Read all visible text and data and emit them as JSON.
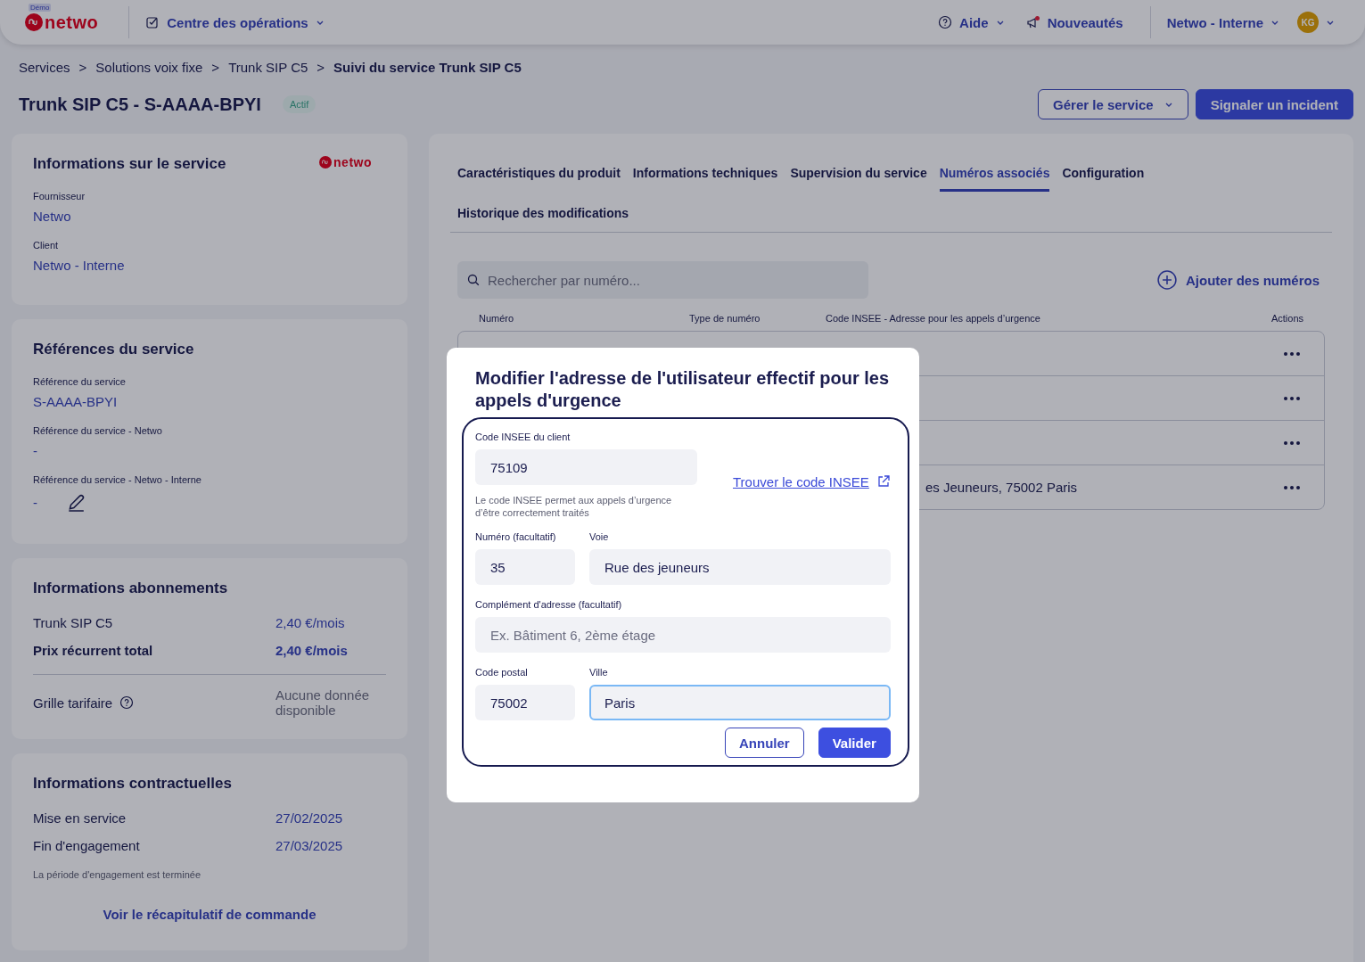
{
  "topbar": {
    "logo": {
      "badge": "Démo",
      "text": "netwo"
    },
    "menu": {
      "label": "Centre des opérations"
    },
    "actions": [
      {
        "kind": "help",
        "label": "Aide",
        "dropdown": true
      },
      {
        "kind": "news",
        "label": "Nouveautés",
        "dropdown": false
      }
    ],
    "account": {
      "label": "Netwo - Interne"
    },
    "avatar": {
      "initials": "KG"
    }
  },
  "breadcrumb": {
    "separator": ">",
    "items": [
      "Services",
      "Solutions voix fixe",
      "Trunk SIP C5",
      "Suivi du service Trunk SIP C5"
    ]
  },
  "header": {
    "title": "Trunk SIP C5 - S-AAAA-BPYI",
    "status": "Actif",
    "buttons": [
      {
        "kind": "outline",
        "label": "Gérer le service",
        "dropdown": true
      },
      {
        "kind": "primary",
        "label": "Signaler un incident",
        "dropdown": false
      }
    ]
  },
  "cards": [
    {
      "kind": "fields",
      "title": "Informations sur le service",
      "logo": "netwo",
      "fields": [
        {
          "label": "Fournisseur",
          "value": "Netwo",
          "editable": false
        },
        {
          "label": "Client",
          "value": "Netwo - Interne",
          "editable": false
        }
      ]
    },
    {
      "kind": "fields",
      "title": "Références du service",
      "fields": [
        {
          "label": "Référence du service",
          "value": "S-AAAA-BPYI",
          "editable": false
        },
        {
          "label": "Référence du service - Netwo",
          "value": "-",
          "editable": false
        },
        {
          "label": "Référence du service - Netwo - Interne",
          "value": "-",
          "editable": true
        }
      ]
    },
    {
      "kind": "prices",
      "title": "Informations abonnements",
      "rows": [
        {
          "label": "Trunk SIP C5",
          "value": "2,40 €/mois",
          "bold": false
        },
        {
          "label": "Prix récurrent total",
          "value": "2,40 €/mois",
          "bold": true
        }
      ],
      "tariff": {
        "label": "Grille tarifaire",
        "value": "Aucune donnée disponible"
      }
    },
    {
      "kind": "contract",
      "title": "Informations contractuelles",
      "rows": [
        {
          "label": "Mise en service",
          "value": "27/02/2025",
          "bold": false
        },
        {
          "label": "Fin d'engagement",
          "value": "27/03/2025",
          "bold": false
        }
      ],
      "note": "La période d'engagement est terminée",
      "link": "Voir le récapitulatif de commande"
    }
  ],
  "panel": {
    "tabs": [
      {
        "label": "Caractéristiques du produit",
        "selected": false
      },
      {
        "label": "Informations techniques",
        "selected": false
      },
      {
        "label": "Supervision du service",
        "selected": false
      },
      {
        "label": "Numéros associés",
        "selected": true
      },
      {
        "label": "Configuration",
        "selected": false
      },
      {
        "label": "Historique des modifications",
        "selected": false
      }
    ],
    "search": {
      "placeholder": "Rechercher par numéro..."
    },
    "add_button": "Ajouter des numéros",
    "table": {
      "columns": [
        "Numéro",
        "Type de numéro",
        "Code INSEE - Adresse pour les appels d’urgence",
        "Actions"
      ],
      "rows": [
        {
          "actions_menu": true
        },
        {
          "actions_menu": true
        },
        {
          "actions_menu": true
        },
        {
          "actions_menu": true,
          "address": "es Jeuneurs, 75002 Paris"
        }
      ]
    }
  },
  "modal": {
    "title": "Modifier l'adresse de l'utilisateur effectif pour les appels d'urgence",
    "insee": {
      "label": "Code INSEE du client",
      "value": "75109",
      "hint": "Le code INSEE permet aux appels d’urgence d’être correctement traités",
      "link": "Trouver le code INSEE"
    },
    "number": {
      "label": "Numéro (facultatif)",
      "value": "35",
      "focused": false
    },
    "street": {
      "label": "Voie",
      "value": "Rue des jeuneurs",
      "focused": false
    },
    "complement": {
      "label": "Complément d'adresse (facultatif)",
      "placeholder": "Ex. Bâtiment 6, 2ème étage",
      "focused": false
    },
    "postal": {
      "label": "Code postal",
      "value": "75002",
      "focused": false
    },
    "city": {
      "label": "Ville",
      "value": "Paris",
      "focused": true
    },
    "buttons": [
      {
        "kind": "outline",
        "label": "Annuler"
      },
      {
        "kind": "primary",
        "label": "Valider"
      }
    ]
  }
}
